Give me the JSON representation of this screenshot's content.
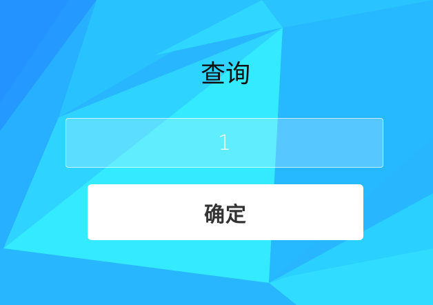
{
  "form": {
    "title": "查询",
    "input_value": "1",
    "input_placeholder": "",
    "confirm_label": "确定"
  },
  "colors": {
    "background": "#27b6ff",
    "accent_light": "#33e8ff",
    "text_dark": "#111111",
    "button_bg": "#ffffff",
    "button_text": "#333333"
  }
}
